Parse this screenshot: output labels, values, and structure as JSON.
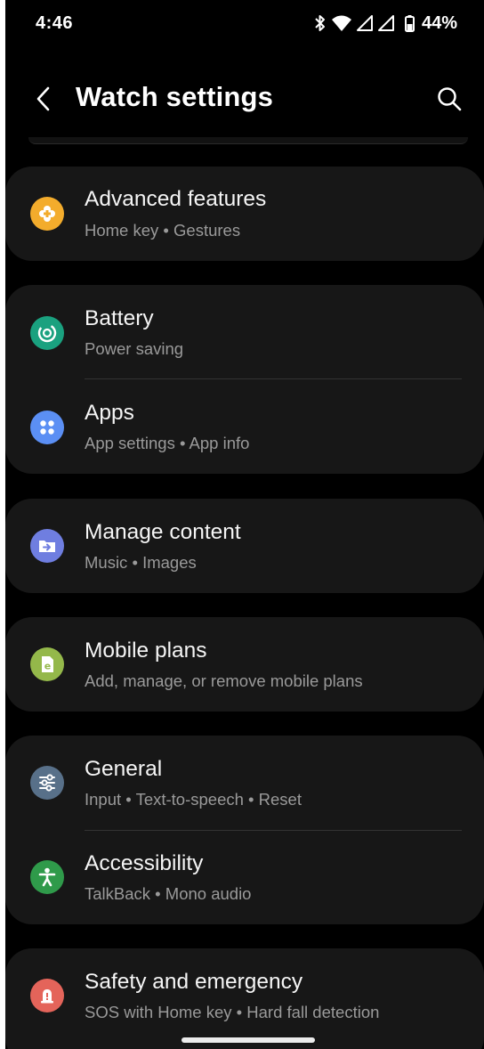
{
  "status_bar": {
    "time": "4:46",
    "battery_percent": "44%"
  },
  "header": {
    "title": "Watch settings",
    "back_icon": "back-arrow-icon",
    "search_icon": "search-icon"
  },
  "colors": {
    "background": "#000000",
    "card": "#171717",
    "title_text": "#f5f5f5",
    "subtitle_text": "#9a9a9a"
  },
  "items": [
    {
      "title": "Advanced features",
      "subtitle": "Home key • Gestures",
      "icon": "advanced-features-icon",
      "icon_color": "#f3ac2c"
    },
    {
      "title": "Battery",
      "subtitle": "Power saving",
      "icon": "battery-icon",
      "icon_color": "#1aa17f"
    },
    {
      "title": "Apps",
      "subtitle": "App settings • App info",
      "icon": "apps-icon",
      "icon_color": "#5b8ff4"
    },
    {
      "title": "Manage content",
      "subtitle": "Music • Images",
      "icon": "manage-content-icon",
      "icon_color": "#6f7ee0"
    },
    {
      "title": "Mobile plans",
      "subtitle": "Add, manage, or remove mobile plans",
      "icon": "mobile-plans-icon",
      "icon_color": "#94b84a"
    },
    {
      "title": "General",
      "subtitle": "Input • Text-to-speech • Reset",
      "icon": "general-icon",
      "icon_color": "#587089"
    },
    {
      "title": "Accessibility",
      "subtitle": "TalkBack • Mono audio",
      "icon": "accessibility-icon",
      "icon_color": "#2f9a4a"
    },
    {
      "title": "Safety and emergency",
      "subtitle": "SOS with Home key • Hard fall detection",
      "icon": "safety-icon",
      "icon_color": "#e4645a"
    }
  ]
}
